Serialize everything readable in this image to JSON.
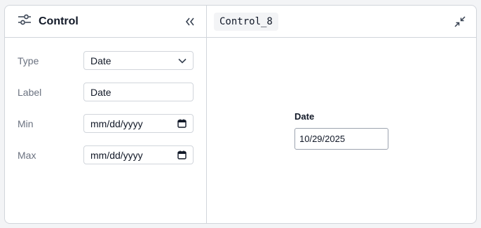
{
  "left_panel": {
    "title": "Control",
    "icons": {
      "settings": "sliders-icon",
      "collapse": "double-chevron-left-icon"
    }
  },
  "form": {
    "type": {
      "label": "Type",
      "value": "Date",
      "icon": "chevron-down-icon"
    },
    "label": {
      "label": "Label",
      "value": "Date"
    },
    "min": {
      "label": "Min",
      "value": "mm/dd/yyyy",
      "icon": "calendar-icon"
    },
    "max": {
      "label": "Max",
      "value": "mm/dd/yyyy",
      "icon": "calendar-icon"
    }
  },
  "right_panel": {
    "name_chip": "Control_8",
    "icons": {
      "minimize": "minimize-icon"
    }
  },
  "preview": {
    "label": "Date",
    "value": "10/29/2025"
  }
}
